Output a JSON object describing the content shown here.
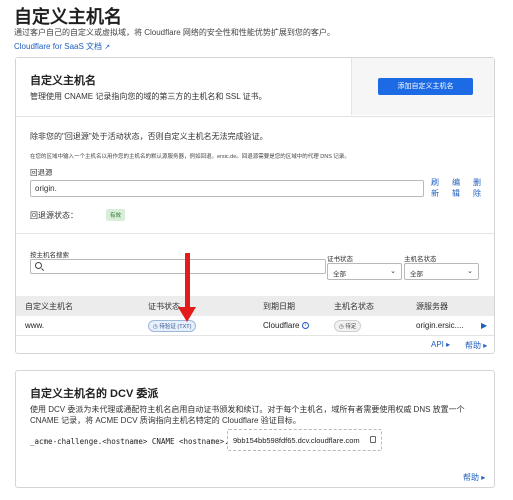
{
  "page": {
    "title": "自定义主机名",
    "description": "通过客户自己的自定义或虚拟域，将 Cloudflare 网络的安全性和性能优势扩展到您的客户。",
    "doc_link": "Cloudflare for SaaS 文档",
    "doc_link_icon": "external-link-icon"
  },
  "custom_hostnames": {
    "title": "自定义主机名",
    "description": "管理使用 CNAME 记录指向您的域的第三方的主机名和 SSL 证书。",
    "add_button": "添加自定义主机名",
    "fallback_warning": "除非您的\"回退源\"处于活动状态，否则自定义主机名无法完成验证。",
    "fallback_instructions": "在您的区域中输入一个主机名以用作您的主机名的默认源服务器，例如回退。ersic.de。回退源需要是您的区域中的代理 DNS 记录。",
    "fallback_label": "回退源",
    "fallback_value": "origin.",
    "actions": [
      "刷新",
      "编辑",
      "删除"
    ],
    "fallback_status_label": "回退源状态：",
    "fallback_status": "有效",
    "search_label": "按主机名搜索",
    "search_placeholder": "",
    "filters": [
      {
        "label": "证书状态",
        "value": "全部"
      },
      {
        "label": "主机名状态",
        "value": "全部"
      }
    ],
    "table": {
      "headers": [
        "自定义主机名",
        "证书状态",
        "到期日期",
        "主机名状态",
        "源服务器"
      ],
      "rows": [
        {
          "hostname": "www.",
          "cert_status": "待验证 (TXT)",
          "expiry": "Cloudflare",
          "hostname_status": "待定",
          "origin": "origin.ersic...."
        }
      ]
    },
    "footer_api": "API",
    "footer_help": "帮助"
  },
  "dcv": {
    "title": "自定义主机名的 DCV 委派",
    "description": "使用 DCV 委派为未代理或通配符主机名启用自动证书颁发和续订。对于每个主机名，域所有者需要使用权威 DNS 放置一个 CNAME 记录，将 ACME DCV 质询指向主机名特定的 Cloudflare 验证目标。",
    "record_prefix": "_acme-challenge.<hostname> CNAME <hostname>.",
    "record_target": "9bb154bb598fdf65.dcv.cloudflare.com",
    "help": "帮助"
  },
  "colors": {
    "accent": "#1d6ae5",
    "link": "#1f5fbf",
    "annotation_arrow": "#e41b1b",
    "status_green": "#2e6b33"
  }
}
